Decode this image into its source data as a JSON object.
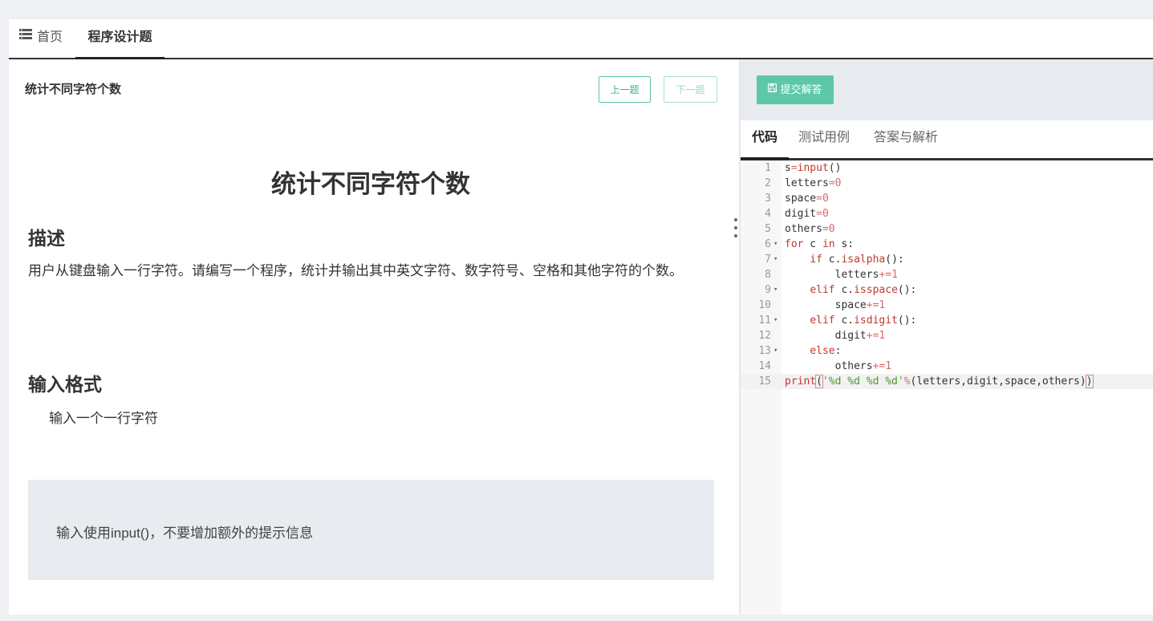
{
  "tabs": {
    "home": "首页",
    "active": "程序设计题"
  },
  "question": {
    "header_title": "统计不同字符个数",
    "prev_label": "上一题",
    "next_label": "下一题",
    "main_title": "统计不同字符个数",
    "desc_heading": "描述",
    "desc_text": "用户从键盘输入一行字符。请编写一个程序，统计并输出其中英文字符、数字符号、空格和其他字符的个数。",
    "input_heading": "输入格式",
    "input_text": "输入一个一行字符",
    "note_text": "输入使用input()，不要增加额外的提示信息"
  },
  "right": {
    "submit_label": "提交解答",
    "tabs": [
      "代码",
      "测试用例",
      "答案与解析"
    ]
  },
  "code": {
    "lines": [
      "s=input()",
      "letters=0",
      "space=0",
      "digit=0",
      "others=0",
      "for c in s:",
      "    if c.isalpha():",
      "        letters+=1",
      "    elif c.isspace():",
      "        space+=1",
      "    elif c.isdigit():",
      "        digit+=1",
      "    else:",
      "        others+=1",
      "print('%d %d %d %d'%(letters,digit,space,others))"
    ],
    "fold_lines": [
      6,
      7,
      9,
      11,
      13
    ],
    "current_line": 15
  },
  "colors": {
    "accent": "#5cc8a8",
    "keyword": "#c0392b",
    "string": "#4a9a2a"
  },
  "icons": {
    "home": "list-icon",
    "submit": "save-icon"
  }
}
